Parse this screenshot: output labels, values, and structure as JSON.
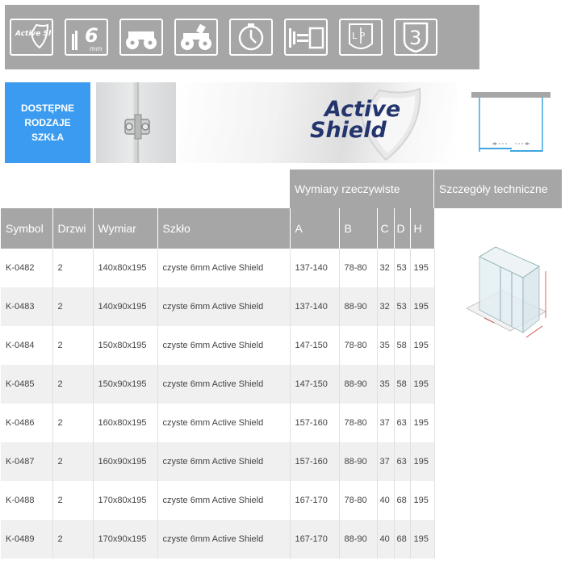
{
  "icons": [
    {
      "name": "active-shield-icon",
      "text": "Active Shield"
    },
    {
      "name": "glass-6mm-icon",
      "text": "6",
      "unit": "mm"
    },
    {
      "name": "rollers-icon"
    },
    {
      "name": "soft-close-rollers-icon"
    },
    {
      "name": "timer-icon"
    },
    {
      "name": "handle-icon"
    },
    {
      "name": "left-right-icon",
      "text": "L P"
    },
    {
      "name": "warranty-3-icon",
      "text": "3"
    }
  ],
  "glass_types": "DOSTĘPNE RODZAJE SZKŁA",
  "brand": {
    "line1": "Active",
    "line2": "Shield"
  },
  "headers": {
    "real_dimensions": "Wymiary rzeczywiste",
    "technical_details": "Szczegóły techniczne"
  },
  "columns": [
    "Symbol",
    "Drzwi",
    "Wymiar",
    "Szkło",
    "A",
    "B",
    "C",
    "D",
    "H"
  ],
  "rows": [
    [
      "K-0482",
      "2",
      "140x80x195",
      "czyste 6mm Active Shield",
      "137-140",
      "78-80",
      "32",
      "53",
      "195"
    ],
    [
      "K-0483",
      "2",
      "140x90x195",
      "czyste 6mm Active Shield",
      "137-140",
      "88-90",
      "32",
      "53",
      "195"
    ],
    [
      "K-0484",
      "2",
      "150x80x195",
      "czyste 6mm Active Shield",
      "147-150",
      "78-80",
      "35",
      "58",
      "195"
    ],
    [
      "K-0485",
      "2",
      "150x90x195",
      "czyste 6mm Active Shield",
      "147-150",
      "88-90",
      "35",
      "58",
      "195"
    ],
    [
      "K-0486",
      "2",
      "160x80x195",
      "czyste 6mm Active Shield",
      "157-160",
      "78-80",
      "37",
      "63",
      "195"
    ],
    [
      "K-0487",
      "2",
      "160x90x195",
      "czyste 6mm Active Shield",
      "157-160",
      "88-90",
      "37",
      "63",
      "195"
    ],
    [
      "K-0488",
      "2",
      "170x80x195",
      "czyste 6mm Active Shield",
      "167-170",
      "78-80",
      "40",
      "68",
      "195"
    ],
    [
      "K-0489",
      "2",
      "170x90x195",
      "czyste 6mm Active Shield",
      "167-170",
      "88-90",
      "40",
      "68",
      "195"
    ]
  ],
  "colors": {
    "header_gray": "#a6a6a6",
    "glass_blue": "#3a9bf0",
    "brand_navy": "#24356e"
  }
}
